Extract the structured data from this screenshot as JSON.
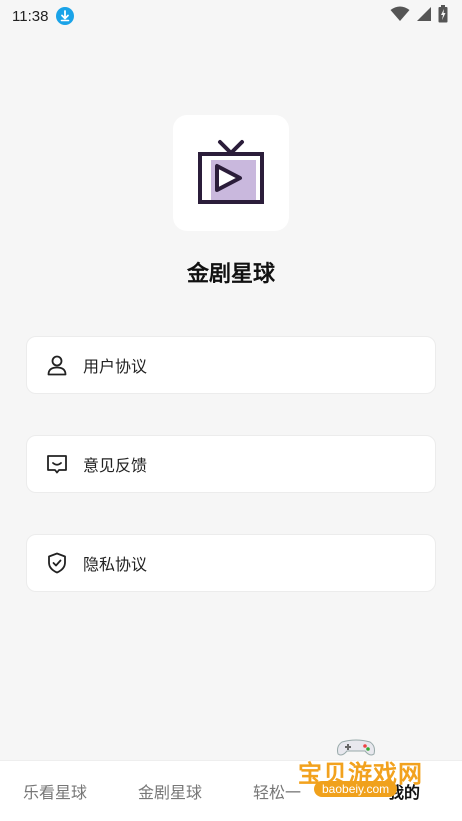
{
  "status_bar": {
    "time": "11:38"
  },
  "app": {
    "name": "金剧星球",
    "icon": "tv-play-icon",
    "icon_color": "#2b1d3a",
    "icon_fill": "#c9b8dd"
  },
  "menu": [
    {
      "label": "用户协议",
      "icon": "user-icon"
    },
    {
      "label": "意见反馈",
      "icon": "feedback-icon"
    },
    {
      "label": "隐私协议",
      "icon": "shield-check-icon"
    }
  ],
  "bottom_nav": {
    "items": [
      {
        "label": "乐看星球"
      },
      {
        "label": "金剧星球"
      },
      {
        "label": "轻松一"
      },
      {
        "label": "我的"
      }
    ],
    "active_index": 3
  },
  "watermark": {
    "title": "宝贝游戏网",
    "domain": "baobeiy.com"
  }
}
